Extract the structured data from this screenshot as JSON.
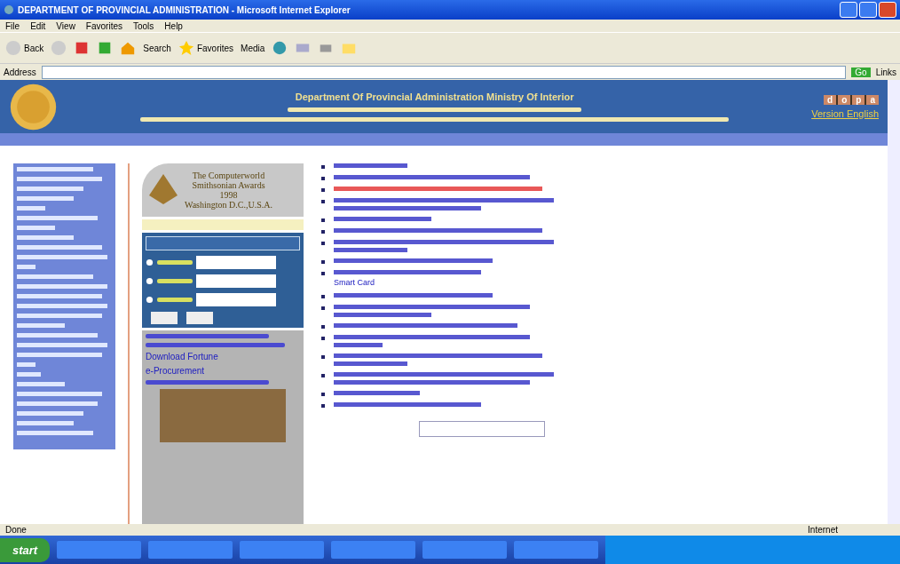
{
  "window": {
    "title": "DEPARTMENT OF PROVINCIAL ADMINISTRATION - Microsoft Internet Explorer"
  },
  "menu": [
    "File",
    "Edit",
    "View",
    "Favorites",
    "Tools",
    "Help"
  ],
  "toolbar": [
    "Back",
    "Search",
    "Favorites",
    "Media"
  ],
  "address": {
    "label": "Address",
    "go": "Go",
    "links": "Links"
  },
  "header": {
    "title": "Department Of Provincial Administration Ministry Of Interior",
    "version_link": "Version English",
    "logo_letters": [
      "d",
      "o",
      "p",
      "a"
    ]
  },
  "award": {
    "lines": [
      "The Computerworld",
      "Smithsonian Awards",
      "1998",
      "Washington D.C.,U.S.A."
    ]
  },
  "side_links": [
    "Download Fortune",
    "e-Procurement"
  ],
  "news_extra": "Smart Card",
  "status_bar": {
    "text": "Done",
    "zone": "Internet"
  },
  "taskbar": {
    "start": "start"
  }
}
